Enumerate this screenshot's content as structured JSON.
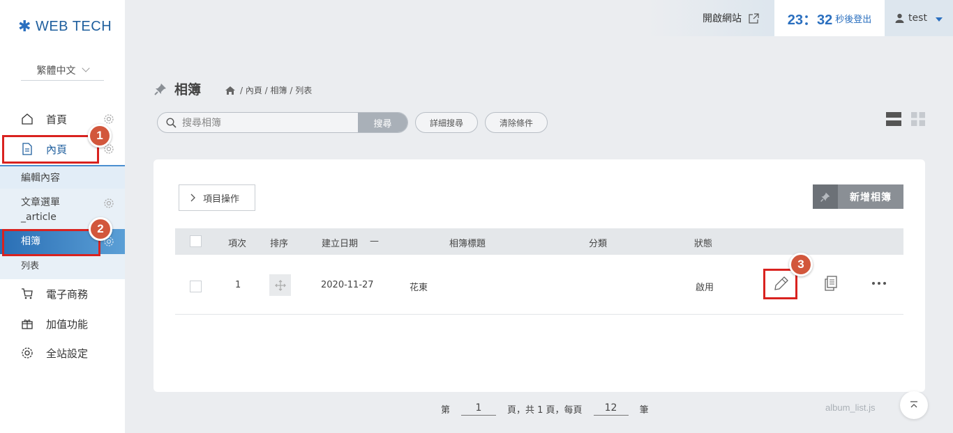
{
  "brand": {
    "logo_text": "WEB TECH"
  },
  "language": {
    "selected": "繁體中文"
  },
  "sidebar": {
    "items": [
      {
        "label": "首頁",
        "icon": "home-icon"
      },
      {
        "label": "內頁",
        "icon": "document-icon"
      },
      {
        "label": "電子商務",
        "icon": "cart-icon"
      },
      {
        "label": "加值功能",
        "icon": "gift-icon"
      },
      {
        "label": "全站設定",
        "icon": "gear-icon"
      }
    ],
    "sub_items": [
      {
        "label": "編輯內容"
      },
      {
        "label": "文章選單",
        "label2": "_article"
      },
      {
        "label": "相簿"
      },
      {
        "label": "列表"
      }
    ]
  },
  "topbar": {
    "open_site_label": "開啟網站",
    "timer_value": "23：32",
    "timer_label": "秒後登出",
    "user_name": "test"
  },
  "page": {
    "title": "相簿",
    "breadcrumb": "/ 內頁 / 相簿 / 列表"
  },
  "search": {
    "placeholder": "搜尋相簿",
    "button_label": "搜尋",
    "advanced_label": "詳細搜尋",
    "clear_label": "清除條件"
  },
  "toolbar": {
    "item_ops_label": "項目操作",
    "add_label": "新增相簿"
  },
  "table": {
    "headers": [
      "項次",
      "排序",
      "建立日期",
      "相簿標題",
      "分類",
      "狀態"
    ],
    "sort_indicator": "—",
    "rows": [
      {
        "index": "1",
        "date": "2020-11-27",
        "title": "花東",
        "category": "",
        "status": "啟用"
      }
    ]
  },
  "pager": {
    "page_prefix": "第",
    "current_page": "1",
    "middle_text": "頁，共 1 頁，每頁",
    "per_page": "12",
    "suffix": "筆"
  },
  "footer": {
    "file_name": "album_list.js"
  },
  "annotations": [
    "1",
    "2",
    "3"
  ],
  "colors": {
    "accent": "#2a6fbf",
    "highlight": "#d9221f",
    "badge": "#d2573c"
  }
}
